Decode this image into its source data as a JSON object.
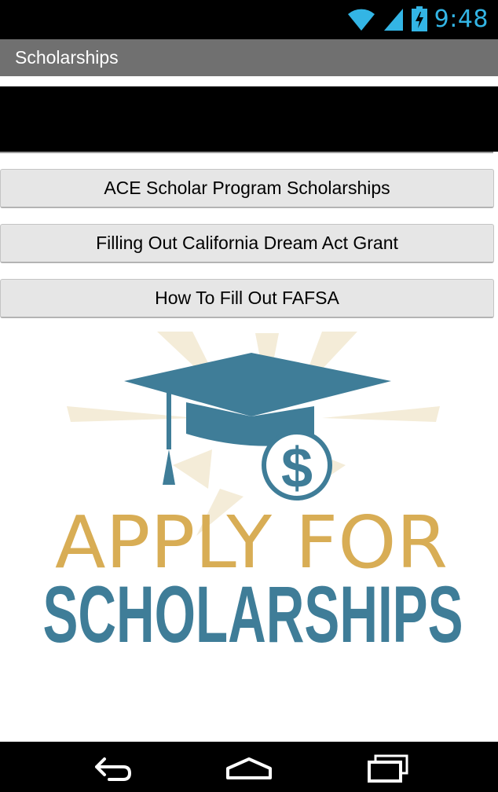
{
  "status_bar": {
    "time": "9:48",
    "icons": [
      "wifi-icon",
      "signal-icon",
      "battery-charging-icon"
    ]
  },
  "action_bar": {
    "title": "Scholarships"
  },
  "buttons": [
    {
      "label": "ACE Scholar Program Scholarships"
    },
    {
      "label": "Filling Out California Dream Act Grant"
    },
    {
      "label": "How To Fill Out FAFSA"
    }
  ],
  "logo": {
    "line1": "APPLY FOR",
    "line2": "SCHOLARSHIPS",
    "symbol": "$",
    "colors": {
      "gold": "#d8ad55",
      "teal": "#3f7d98",
      "starburst": "#f4ecd8"
    }
  },
  "nav_bar": {
    "icons": [
      "back-icon",
      "home-icon",
      "recent-apps-icon"
    ]
  },
  "colors": {
    "status_time": "#33b5e5",
    "title_bar": "#707070",
    "button_bg": "#e6e6e6"
  }
}
